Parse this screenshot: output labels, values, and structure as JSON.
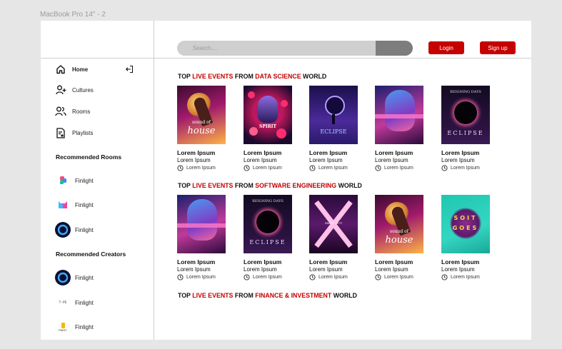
{
  "frame_label": "MacBook Pro 14\" - 2",
  "nav": [
    {
      "label": "Home",
      "icon": "home-icon",
      "active": true
    },
    {
      "label": "Cultures",
      "icon": "add-user-icon"
    },
    {
      "label": "Rooms",
      "icon": "users-icon"
    },
    {
      "label": "Playlists",
      "icon": "playlist-icon"
    }
  ],
  "recommended_rooms": {
    "title": "Recommended Rooms",
    "items": [
      {
        "label": "Finlight",
        "icon": "room-logo-1"
      },
      {
        "label": "Finlight",
        "icon": "room-logo-2"
      },
      {
        "label": "Finlight",
        "icon": "room-logo-3"
      }
    ]
  },
  "recommended_creators": {
    "title": "Recommended Creators",
    "items": [
      {
        "label": "Finlight",
        "icon": "creator-logo-1"
      },
      {
        "label": "Finlight",
        "icon": "creator-logo-2",
        "logo_text": "T-PE"
      },
      {
        "label": "Finlight",
        "icon": "creator-logo-3",
        "logo_text": "PAINT"
      }
    ]
  },
  "search": {
    "placeholder": "Search...."
  },
  "auth": {
    "login": "Login",
    "signup": "Sign up"
  },
  "sections": [
    {
      "prefix": "TOP",
      "highlight": "LIVE EVENTS",
      "mid": "FROM",
      "topic": "DATA SCIENCE",
      "suffix": "WORLD"
    },
    {
      "prefix": "TOP",
      "highlight": "LIVE EVENTS",
      "mid": "FROM",
      "topic": "SOFTWARE ENGINEERING",
      "suffix": "WORLD"
    },
    {
      "prefix": "TOP",
      "highlight": "LIVE EVENTS",
      "mid": "FROM",
      "topic": "FINANCE & INVESTMENT",
      "suffix": "WORLD"
    }
  ],
  "cards": {
    "title": "Lorem Ipsum",
    "subtitle": "Lorem Ipsum",
    "time": "Lorem Ipsum"
  },
  "poster_texts": {
    "sound_small": "sound of",
    "sound_big": "house",
    "eclipse": "ECLIPSE",
    "reigning": "REIGNING DAYS",
    "spirit": "SPIRIT",
    "party": "PARTY OUT",
    "soit": "SOIT",
    "goes": "GOES"
  },
  "colors": {
    "accent": "#c60000",
    "search_bg": "#cfcfcf",
    "search_btn": "#7d7d7d"
  }
}
